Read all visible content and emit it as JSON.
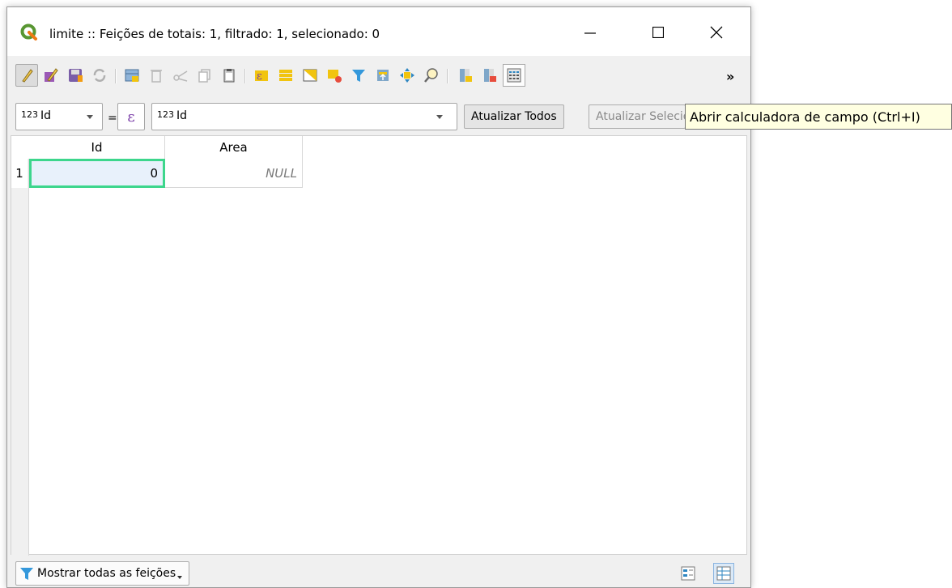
{
  "window": {
    "title": "limite :: Feições de totais: 1, filtrado: 1, selecionado: 0",
    "controls": [
      "minimize",
      "maximize",
      "close"
    ]
  },
  "toolbar": {
    "icons": [
      "toggle-editing-icon",
      "multi-edit-icon",
      "save-edits-icon",
      "reload-icon",
      "add-feature-icon",
      "delete-feature-icon",
      "cut-icon",
      "copy-icon",
      "paste-icon",
      "select-by-expression-icon",
      "select-all-icon",
      "invert-selection-icon",
      "deselect-all-icon",
      "filter-icon",
      "move-selection-top-icon",
      "pan-to-selection-icon",
      "zoom-to-selection-icon",
      "new-field-icon",
      "delete-field-icon",
      "field-calculator-icon"
    ],
    "more_label": "»"
  },
  "expression_bar": {
    "field_combo_prefix": "123",
    "field_combo_value": "Id",
    "equals_label": "=",
    "epsilon_label": "ε",
    "expression_prefix": "123",
    "expression_value": "Id",
    "update_all_label": "Atualizar Todos",
    "update_selected_label": "Atualizar Selecionadas"
  },
  "table": {
    "columns": [
      "Id",
      "Area"
    ],
    "rows": [
      {
        "row_header": "1",
        "cells": [
          "0",
          "NULL"
        ]
      }
    ]
  },
  "status_bar": {
    "filter_label": "Mostrar todas as feições"
  },
  "tooltip": {
    "text": "Abrir calculadora de campo (Ctrl+I)"
  },
  "colors": {
    "accent_green": "#3dd68c",
    "cell_selected_bg": "#e8f1fb",
    "tooltip_bg": "#ffffe1"
  }
}
